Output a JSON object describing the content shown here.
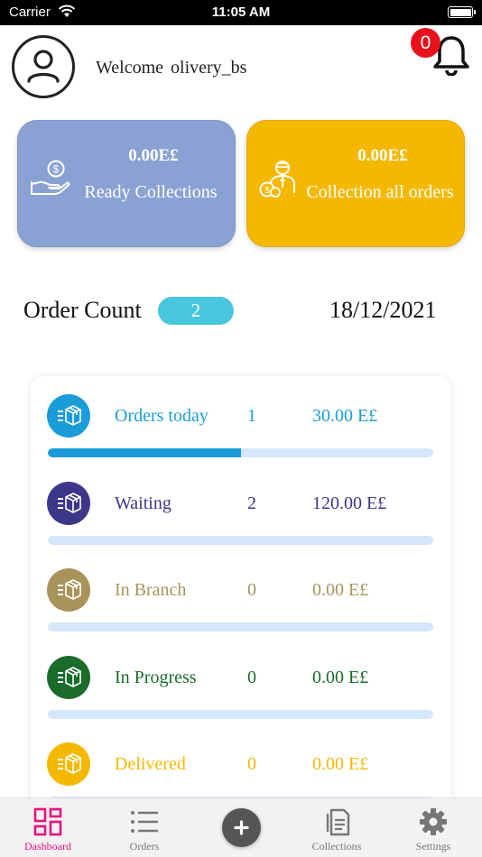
{
  "status_bar": {
    "carrier": "Carrier",
    "time": "11:05 AM"
  },
  "header": {
    "welcome": "Welcome",
    "username": "olivery_bs",
    "notification_count": "0"
  },
  "cards": {
    "ready": {
      "amount": "0.00E£",
      "label": "Ready Collections",
      "color": "#8aa2d3"
    },
    "all": {
      "amount": "0.00E£",
      "label": "Collection all orders",
      "color": "#f5b800"
    }
  },
  "order_count": {
    "label": "Order Count",
    "value": "2",
    "date": "18/12/2021"
  },
  "statuses": [
    {
      "name": "Orders today",
      "count": "1",
      "amount": "30.00 E£",
      "color": "#1a9cd9",
      "progress": 0.5
    },
    {
      "name": "Waiting",
      "count": "2",
      "amount": "120.00 E£",
      "color": "#3c3788",
      "progress": 0
    },
    {
      "name": "In Branch",
      "count": "0",
      "amount": "0.00 E£",
      "color": "#a8945a",
      "progress": 0
    },
    {
      "name": "In Progress",
      "count": "0",
      "amount": "0.00 E£",
      "color": "#1b6b2b",
      "progress": 0
    },
    {
      "name": "Delivered",
      "count": "0",
      "amount": "0.00 E£",
      "color": "#f5b800",
      "progress": 0
    }
  ],
  "tabs": {
    "dashboard": "Dashboard",
    "orders": "Orders",
    "collections": "Collections",
    "settings": "Settings",
    "active_color": "#e8137e"
  },
  "icons": {
    "avatar": "user-circle-icon",
    "bell": "bell-icon",
    "ready": "money-hand-icon",
    "all": "courier-coins-icon",
    "status": "box-list-icon",
    "fab": "plus-icon"
  }
}
